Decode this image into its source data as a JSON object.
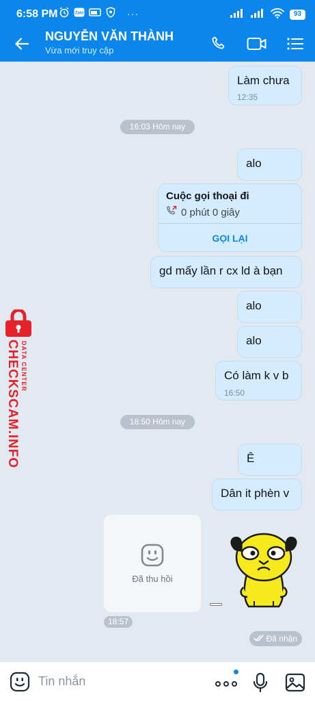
{
  "status_bar": {
    "time": "6:58 PM",
    "dots": "···",
    "battery": "93",
    "icons": [
      "alarm-icon",
      "zalo-icon",
      "cast-icon",
      "vpn-icon",
      "signal-icon",
      "signal-icon",
      "wifi-icon",
      "battery-icon"
    ]
  },
  "header": {
    "contact_name": "NGUYỄN VĂN THÀNH",
    "contact_status": "Vừa mới truy cập",
    "icons": [
      "back-arrow-icon",
      "phone-icon",
      "video-call-icon",
      "menu-list-icon"
    ]
  },
  "chat": {
    "msg_1": {
      "text": "Làm chưa",
      "time": "12:35"
    },
    "date_1": "16:03 Hôm nay",
    "msg_2": {
      "text": "alo"
    },
    "call": {
      "title": "Cuộc gọi thoại đi",
      "duration": "0 phút 0 giây",
      "action": "GỌI LẠI"
    },
    "msg_3": {
      "text": "gd mấy lần r cx ld à bạn"
    },
    "msg_4": {
      "text": "alo"
    },
    "msg_5": {
      "text": "alo"
    },
    "msg_6": {
      "text": "Có làm k v b",
      "time": "16:50"
    },
    "date_2": "18:50 Hôm nay",
    "msg_7": {
      "text": "Ê"
    },
    "msg_8": {
      "text": "Dân it phèn v"
    },
    "recalled": {
      "label": "Đã thu hồi",
      "time": "18:57"
    },
    "receipt": "Đã nhận"
  },
  "watermark": {
    "main": "CHECKSCAM.INFO",
    "sub": "DATA CENTER"
  },
  "input_bar": {
    "placeholder": "Tin nhắn",
    "icons": [
      "emoji-icon",
      "more-icon",
      "mic-icon",
      "image-icon"
    ]
  },
  "colors": {
    "brand_blue": "#0a86ec",
    "bubble_bg": "#d4ecfe",
    "chat_bg": "#e2e9f1",
    "watermark_red": "#e5222a"
  }
}
